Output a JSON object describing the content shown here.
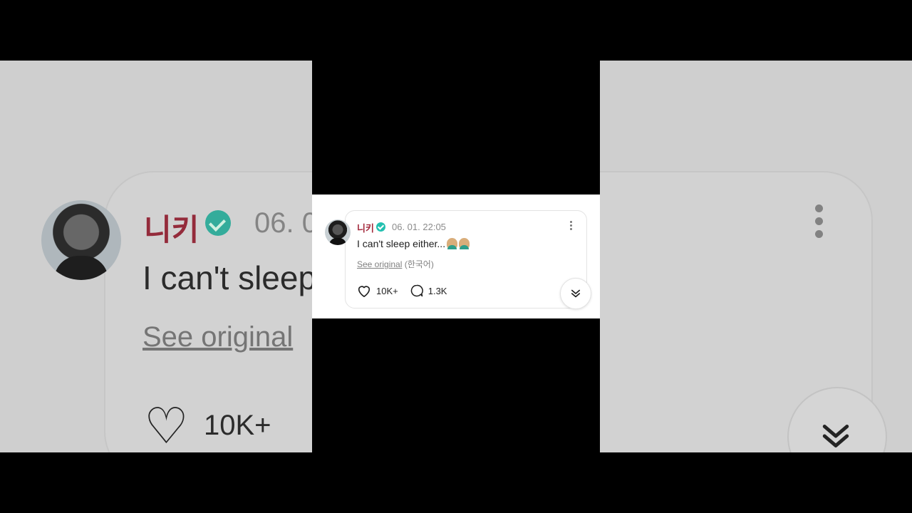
{
  "post": {
    "author": "니키",
    "time": "06. 01. 22:05",
    "text": "I can't sleep either...",
    "see_original": "See original",
    "original_language": "(한국어)",
    "likes": "10K+",
    "comments": "1.3K"
  },
  "backdrop": {
    "author": "니키",
    "time": "06. 0",
    "text": "I can't sleep",
    "see_original": "See original",
    "likes": "10K+"
  },
  "icons": {
    "verified": "verified-badge-icon",
    "more": "more-vertical-icon",
    "like": "heart-icon",
    "comment": "comment-bubble-icon",
    "scroll": "double-chevron-down-icon",
    "emoji": "man-gesturing-emoji-icon"
  },
  "colors": {
    "author": "#a3283b",
    "verified": "#23c0b0",
    "background": "#000000"
  }
}
